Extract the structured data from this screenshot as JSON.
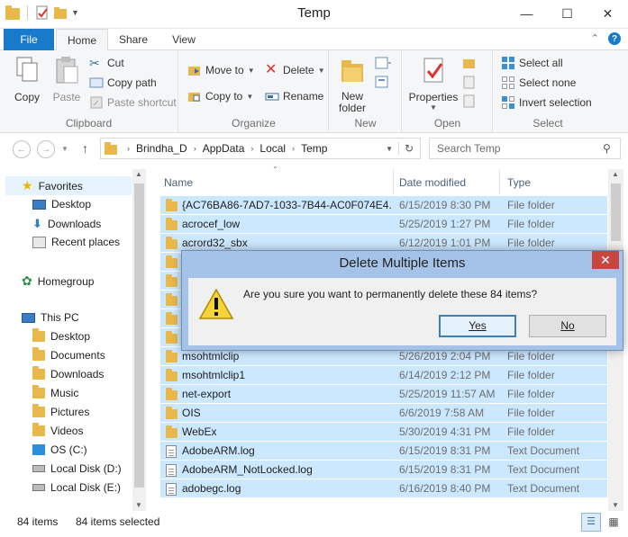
{
  "window": {
    "title": "Temp",
    "controls": {
      "minimize": "—",
      "maximize": "☐",
      "close": "✕"
    }
  },
  "ribbon": {
    "tabs": [
      {
        "label": "File"
      },
      {
        "label": "Home"
      },
      {
        "label": "Share"
      },
      {
        "label": "View"
      }
    ],
    "clipboard": {
      "label": "Clipboard",
      "copy": "Copy",
      "paste": "Paste",
      "cut": "Cut",
      "copy_path": "Copy path",
      "paste_shortcut": "Paste shortcut"
    },
    "organize": {
      "label": "Organize",
      "move_to": "Move to",
      "copy_to": "Copy to",
      "delete": "Delete",
      "rename": "Rename"
    },
    "new": {
      "label": "New",
      "new_folder": "New folder"
    },
    "open": {
      "label": "Open",
      "properties": "Properties"
    },
    "select": {
      "label": "Select",
      "select_all": "Select all",
      "select_none": "Select none",
      "invert_selection": "Invert selection"
    }
  },
  "address": {
    "path": [
      "Brindha_D",
      "AppData",
      "Local",
      "Temp"
    ],
    "search_placeholder": "Search Temp"
  },
  "nav": {
    "favorites": "Favorites",
    "favorites_items": [
      "Desktop",
      "Downloads",
      "Recent places"
    ],
    "homegroup": "Homegroup",
    "thispc": "This PC",
    "thispc_items": [
      "Desktop",
      "Documents",
      "Downloads",
      "Music",
      "Pictures",
      "Videos",
      "OS (C:)",
      "Local Disk (D:)",
      "Local Disk (E:)"
    ]
  },
  "columns": {
    "name": "Name",
    "date": "Date modified",
    "type": "Type"
  },
  "files": [
    {
      "name": "{AC76BA86-7AD7-1033-7B44-AC0F074E4...",
      "date": "6/15/2019 8:30 PM",
      "type": "File folder",
      "kind": "folder"
    },
    {
      "name": "acrocef_low",
      "date": "5/25/2019 1:27 PM",
      "type": "File folder",
      "kind": "folder"
    },
    {
      "name": "acrord32_sbx",
      "date": "6/12/2019 1:01 PM",
      "type": "File folder",
      "kind": "folder"
    },
    {
      "name": "",
      "date": "",
      "type": "",
      "kind": "folder"
    },
    {
      "name": "",
      "date": "",
      "type": "",
      "kind": "folder"
    },
    {
      "name": "",
      "date": "",
      "type": "",
      "kind": "folder"
    },
    {
      "name": "",
      "date": "",
      "type": "",
      "kind": "folder"
    },
    {
      "name": "",
      "date": "",
      "type": "",
      "kind": "folder"
    },
    {
      "name": "msohtmlclip",
      "date": "5/26/2019 2:04 PM",
      "type": "File folder",
      "kind": "folder"
    },
    {
      "name": "msohtmlclip1",
      "date": "6/14/2019 2:12 PM",
      "type": "File folder",
      "kind": "folder"
    },
    {
      "name": "net-export",
      "date": "5/25/2019 11:57 AM",
      "type": "File folder",
      "kind": "folder"
    },
    {
      "name": "OIS",
      "date": "6/6/2019 7:58 AM",
      "type": "File folder",
      "kind": "folder"
    },
    {
      "name": "WebEx",
      "date": "5/30/2019 4:31 PM",
      "type": "File folder",
      "kind": "folder"
    },
    {
      "name": "AdobeARM.log",
      "date": "6/15/2019 8:31 PM",
      "type": "Text Document",
      "kind": "file"
    },
    {
      "name": "AdobeARM_NotLocked.log",
      "date": "6/15/2019 8:31 PM",
      "type": "Text Document",
      "kind": "file"
    },
    {
      "name": "adobegc.log",
      "date": "6/16/2019 8:40 PM",
      "type": "Text Document",
      "kind": "file"
    }
  ],
  "status": {
    "count": "84 items",
    "selected": "84 items selected"
  },
  "dialog": {
    "title": "Delete Multiple Items",
    "message": "Are you sure you want to permanently delete these 84 items?",
    "yes": "Yes",
    "no": "No",
    "close": "✕"
  }
}
